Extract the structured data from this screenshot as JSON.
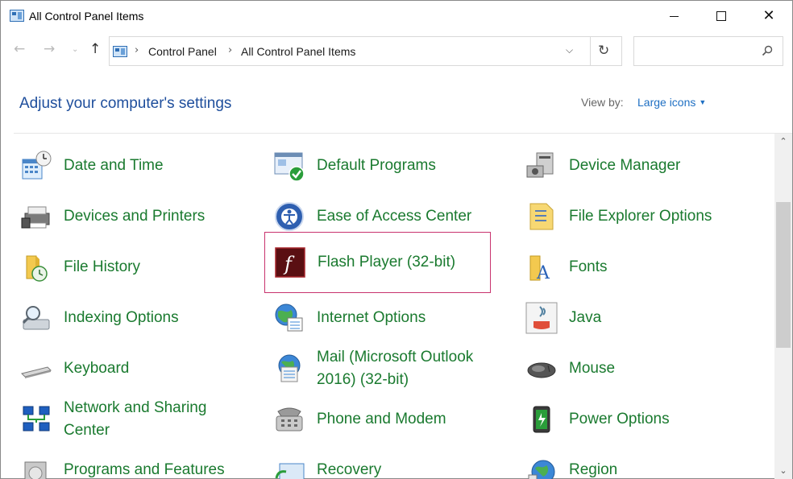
{
  "window": {
    "title": "All Control Panel Items",
    "minimize_glyph": "",
    "maximize_glyph": "",
    "close_glyph": "✕"
  },
  "nav": {
    "back_glyph": "←",
    "forward_glyph": "→",
    "recent_glyph": "⌄",
    "up_glyph": "↑",
    "breadcrumb": [
      "Control Panel",
      "All Control Panel Items"
    ],
    "separator": "›",
    "dropdown_glyph": "⌵",
    "refresh_glyph": "↻",
    "search_placeholder": ""
  },
  "header": {
    "title": "Adjust your computer's settings",
    "view_by_label": "View by:",
    "view_mode": "Large icons",
    "view_caret": "▼"
  },
  "colors": {
    "title_blue": "#1e4e9c",
    "link_blue": "#1e6fc3",
    "item_green": "#1a7a2f",
    "selection_border": "#c8326e"
  },
  "items": [
    {
      "label": "Date and Time",
      "icon": "date-time-icon"
    },
    {
      "label": "Default Programs",
      "icon": "default-programs-icon"
    },
    {
      "label": "Device Manager",
      "icon": "device-manager-icon"
    },
    {
      "label": "Devices and Printers",
      "icon": "devices-printers-icon"
    },
    {
      "label": "Ease of Access Center",
      "icon": "ease-of-access-icon"
    },
    {
      "label": "File Explorer Options",
      "icon": "file-explorer-options-icon"
    },
    {
      "label": "File History",
      "icon": "file-history-icon"
    },
    {
      "label": "Flash Player (32-bit)",
      "icon": "flash-player-icon",
      "highlighted": true
    },
    {
      "label": "Fonts",
      "icon": "fonts-icon"
    },
    {
      "label": "Indexing Options",
      "icon": "indexing-options-icon"
    },
    {
      "label": "Internet Options",
      "icon": "internet-options-icon"
    },
    {
      "label": "Java",
      "icon": "java-icon"
    },
    {
      "label": "Keyboard",
      "icon": "keyboard-icon"
    },
    {
      "label": "Mail (Microsoft Outlook 2016) (32-bit)",
      "label_lines": [
        "Mail (Microsoft Outlook",
        "2016) (32-bit)"
      ],
      "icon": "mail-icon"
    },
    {
      "label": "Mouse",
      "icon": "mouse-icon"
    },
    {
      "label": "Network and Sharing Center",
      "label_lines": [
        "Network and Sharing",
        "Center"
      ],
      "icon": "network-sharing-icon"
    },
    {
      "label": "Phone and Modem",
      "icon": "phone-modem-icon"
    },
    {
      "label": "Power Options",
      "icon": "power-options-icon"
    },
    {
      "label": "Programs and Features",
      "icon": "programs-features-icon"
    },
    {
      "label": "Recovery",
      "icon": "recovery-icon"
    },
    {
      "label": "Region",
      "icon": "region-icon"
    }
  ],
  "scrollbar": {
    "up_glyph": "⌃",
    "down_glyph": "⌄"
  }
}
